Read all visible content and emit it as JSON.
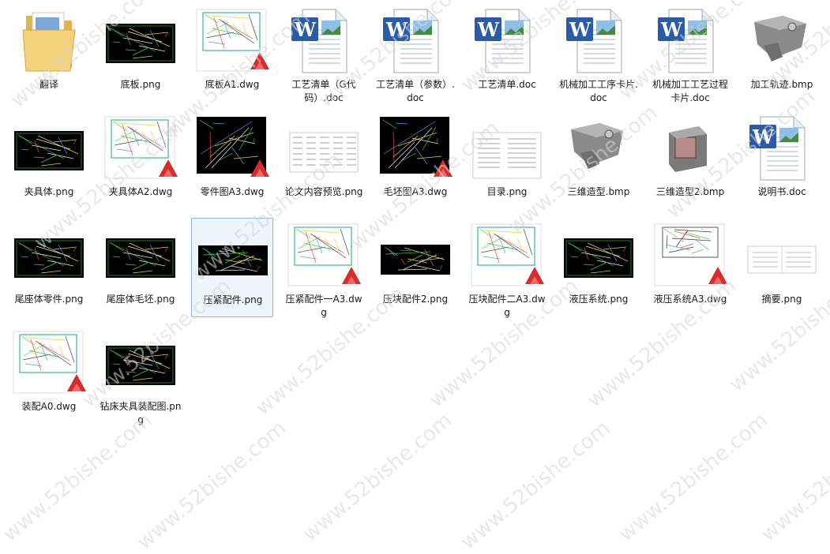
{
  "watermark": "www.52bishe.com",
  "files": [
    {
      "name": "翻译",
      "icon": "folder-icon",
      "type": "folder"
    },
    {
      "name": "底板.png",
      "icon": "cad-black-thumbnail",
      "type": "cad-black"
    },
    {
      "name": "底板A1.dwg",
      "icon": "dwg-icon",
      "type": "dwg"
    },
    {
      "name": "工艺清单（G代码）.doc",
      "icon": "word-doc-icon",
      "type": "doc"
    },
    {
      "name": "工艺清单（参数）.doc",
      "icon": "word-doc-icon",
      "type": "doc"
    },
    {
      "name": "工艺清单.doc",
      "icon": "word-doc-icon",
      "type": "doc"
    },
    {
      "name": "机械加工工序卡片.doc",
      "icon": "word-doc-icon",
      "type": "doc"
    },
    {
      "name": "机械加工工艺过程卡片.doc",
      "icon": "word-doc-icon",
      "type": "doc"
    },
    {
      "name": "加工轨迹.bmp",
      "icon": "3d-part-thumbnail",
      "type": "model3d"
    },
    {
      "name": "夹具体.png",
      "icon": "cad-black-thumbnail",
      "type": "cad-black"
    },
    {
      "name": "夹具体A2.dwg",
      "icon": "dwg-icon",
      "type": "dwg"
    },
    {
      "name": "零件图A3.dwg",
      "icon": "dwg-icon",
      "type": "dwg-black"
    },
    {
      "name": "论文内容预览.png",
      "icon": "document-preview-thumbnail",
      "type": "doc-preview"
    },
    {
      "name": "毛坯图A3.dwg",
      "icon": "dwg-icon",
      "type": "dwg-black"
    },
    {
      "name": "目录.png",
      "icon": "document-preview-thumbnail",
      "type": "page-preview"
    },
    {
      "name": "三维造型.bmp",
      "icon": "3d-part-thumbnail",
      "type": "model3d"
    },
    {
      "name": "三维造型2.bmp",
      "icon": "3d-part-thumbnail",
      "type": "model3d-b"
    },
    {
      "name": "说明书.doc",
      "icon": "word-doc-icon",
      "type": "doc"
    },
    {
      "name": "尾座体零件.png",
      "icon": "cad-black-thumbnail",
      "type": "cad-black"
    },
    {
      "name": "尾座体毛坯.png",
      "icon": "cad-black-thumbnail",
      "type": "cad-black"
    },
    {
      "name": "压紧配件.png",
      "icon": "cad-black-thumbnail",
      "type": "cad-black-small",
      "selected": true
    },
    {
      "name": "压紧配件一A3.dwg",
      "icon": "dwg-icon",
      "type": "dwg"
    },
    {
      "name": "压块配件2.png",
      "icon": "cad-black-thumbnail",
      "type": "cad-black-small"
    },
    {
      "name": "压块配件二A3.dwg",
      "icon": "dwg-icon",
      "type": "dwg"
    },
    {
      "name": "液压系统.png",
      "icon": "cad-black-thumbnail",
      "type": "cad-black"
    },
    {
      "name": "液压系统A3.dwg",
      "icon": "dwg-icon",
      "type": "dwg-white"
    },
    {
      "name": "摘要.png",
      "icon": "document-preview-thumbnail",
      "type": "page-spread"
    },
    {
      "name": "装配A0.dwg",
      "icon": "dwg-icon",
      "type": "dwg"
    },
    {
      "name": "钻床夹具装配图.png",
      "icon": "cad-black-thumbnail",
      "type": "cad-black"
    }
  ]
}
